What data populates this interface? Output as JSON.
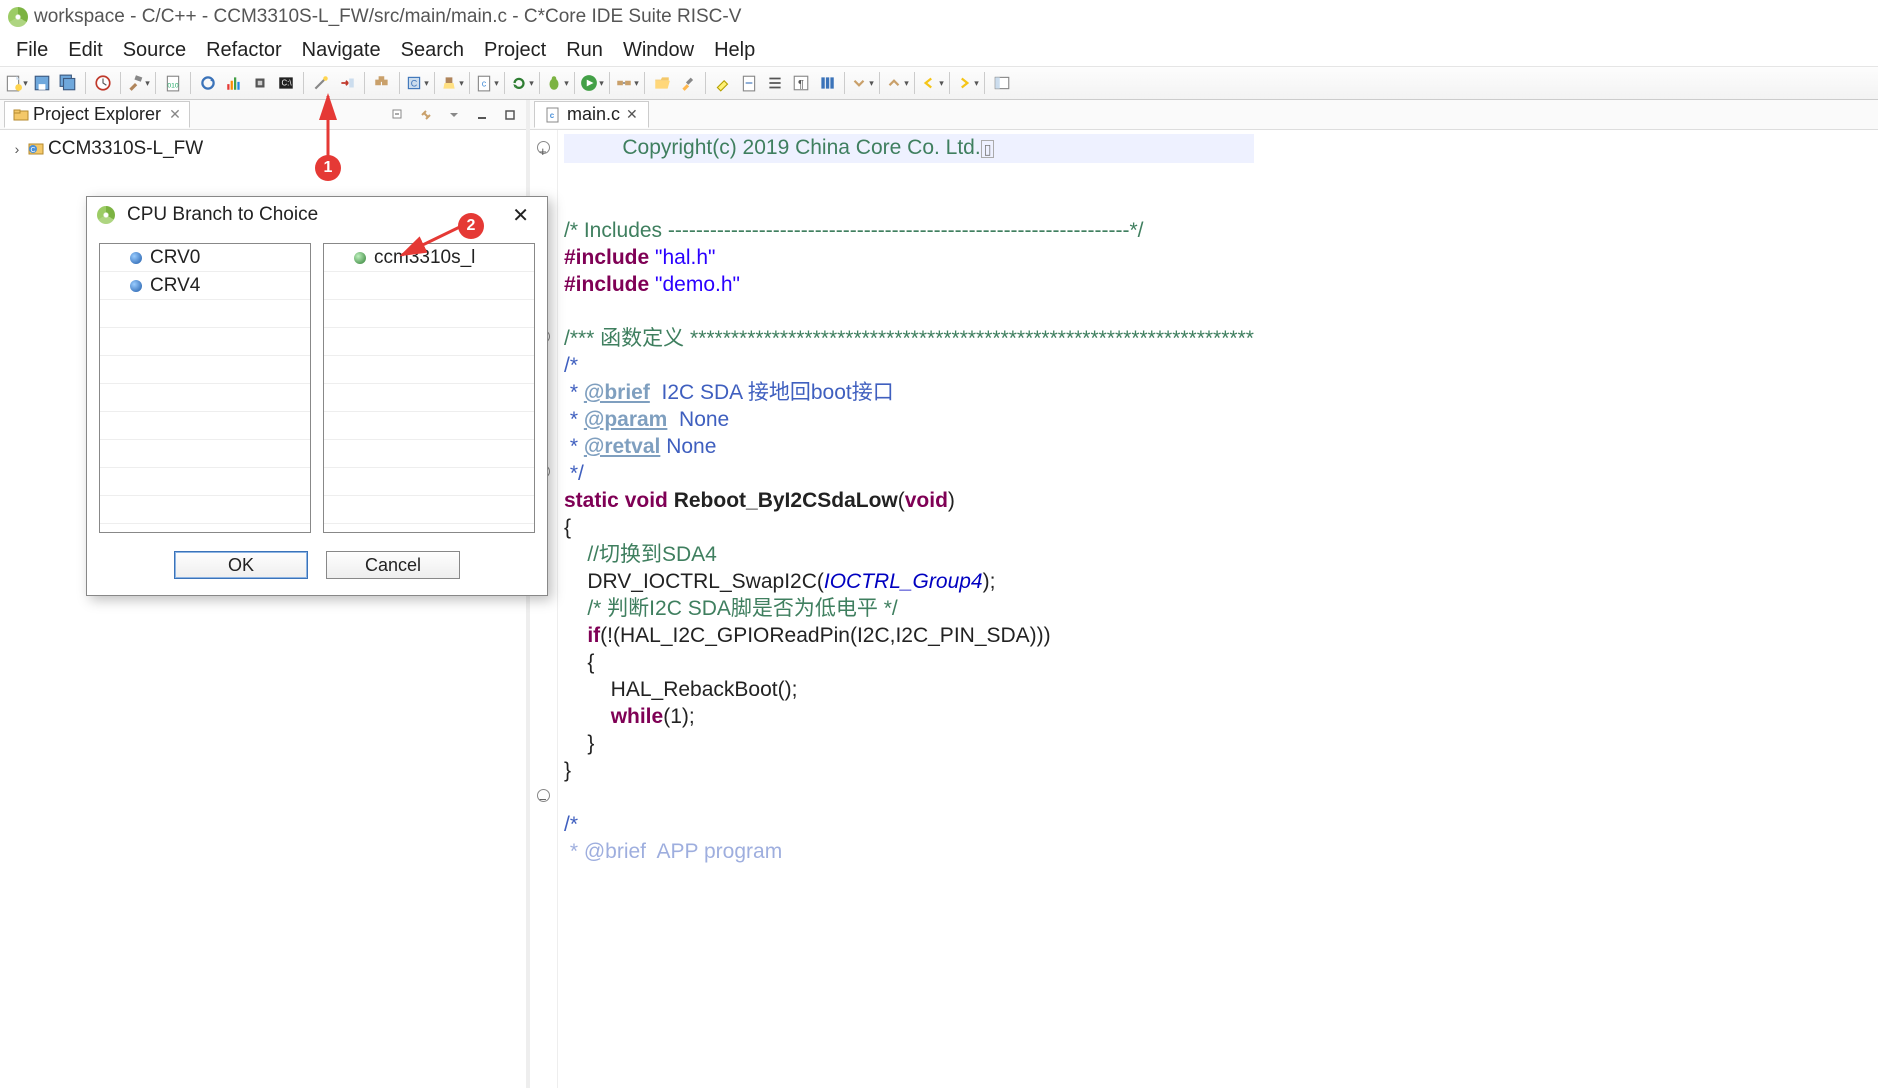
{
  "app": {
    "title": "workspace - C/C++ - CCM3310S-L_FW/src/main/main.c - C*Core IDE Suite RISC-V",
    "menus": [
      "File",
      "Edit",
      "Source",
      "Refactor",
      "Navigate",
      "Search",
      "Project",
      "Run",
      "Window",
      "Help"
    ]
  },
  "toolbar_icons": [
    "new-wizard-icon",
    "save-icon",
    "save-all-icon",
    "sep",
    "clock-icon",
    "sep",
    "hammer-build-icon",
    "sep",
    "binary-file-icon",
    "sep",
    "refresh-blue-icon",
    "spectrum-icon",
    "cpu-icon",
    "console-icon",
    "sep",
    "wand-icon",
    "step-icon",
    "sep",
    "packages-icon",
    "sep",
    "box-c-icon",
    "sep",
    "clean-icon",
    "sep",
    "file-c-icon",
    "sep",
    "cycle-icon",
    "sep",
    "bug-run-icon",
    "sep",
    "play-run-icon",
    "sep",
    "connect-icon",
    "sep",
    "open-folder-icon",
    "brush-icon",
    "sep",
    "highlighter-icon",
    "doc-step-icon",
    "list-icon",
    "pi-icon",
    "bars-icon",
    "sep",
    "nav-down-icon",
    "sep",
    "nav-up-icon",
    "sep",
    "back-icon",
    "sep",
    "forward-icon",
    "sep",
    "toggle-pane-icon"
  ],
  "project_explorer": {
    "title": "Project Explorer",
    "toolbar_icons": [
      "collapse-all-icon",
      "link-editor-icon",
      "view-menu-icon",
      "minimize-icon",
      "maximize-icon"
    ],
    "root": "CCM3310S-L_FW"
  },
  "dialog": {
    "title": "CPU Branch to Choice",
    "left_list": [
      "CRV0",
      "CRV4"
    ],
    "right_list": [
      "ccm3310s_l"
    ],
    "ok": "OK",
    "cancel": "Cancel"
  },
  "editor": {
    "filename": "main.c",
    "code": {
      "l1a": "          Copyright(c) 2019 China Core Co. Ltd.",
      "l3": "/* Includes ------------------------------------------------------------------*/",
      "l4a": "#include",
      "l4b": " \"hal.h\"",
      "l5a": "#include",
      "l5b": " \"demo.h\"",
      "l7": "/*** 函数定义 *********************************************************************",
      "l8": "/*",
      "l9a": " * ",
      "l9b": "@brief",
      "l9c": "  I2C SDA 接地回boot接口",
      "l10a": " * ",
      "l10b": "@param",
      "l10c": "  None",
      "l11a": " * ",
      "l11b": "@retval",
      "l11c": " None",
      "l12": " */",
      "l13a": "static",
      "l13b": " void",
      "l13c": " Reboot_ByI2CSdaLow",
      "l13d": "(",
      "l13e": "void",
      "l13f": ")",
      "l14": "{",
      "l15": "    //切换到SDA4",
      "l16a": "    DRV_IOCTRL_SwapI2C(",
      "l16b": "IOCTRL_Group4",
      "l16c": ");",
      "l17": "    /* 判断I2C SDA脚是否为低电平 */",
      "l18a": "    ",
      "l18b": "if",
      "l18c": "(!(HAL_I2C_GPIOReadPin(I2C,I2C_PIN_SDA)))",
      "l19": "    {",
      "l20": "        HAL_RebackBoot();",
      "l21a": "        ",
      "l21b": "while",
      "l21c": "(1);",
      "l22": "    }",
      "l23": "}",
      "l25": "/*",
      "l26": " * @brief  APP program"
    }
  },
  "callouts": {
    "one": "1",
    "two": "2"
  }
}
